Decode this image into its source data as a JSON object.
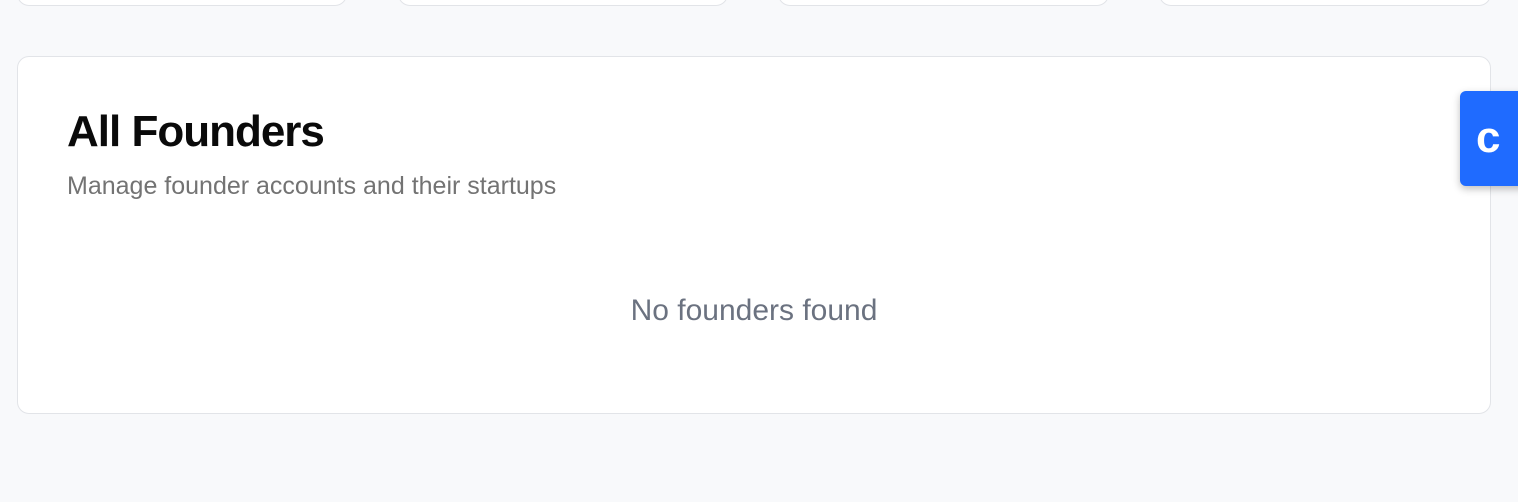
{
  "founders_panel": {
    "title": "All Founders",
    "subtitle": "Manage founder accounts and their startups",
    "empty_message": "No founders found"
  },
  "side_widget": {
    "label": "c",
    "color": "#1f6bff"
  }
}
